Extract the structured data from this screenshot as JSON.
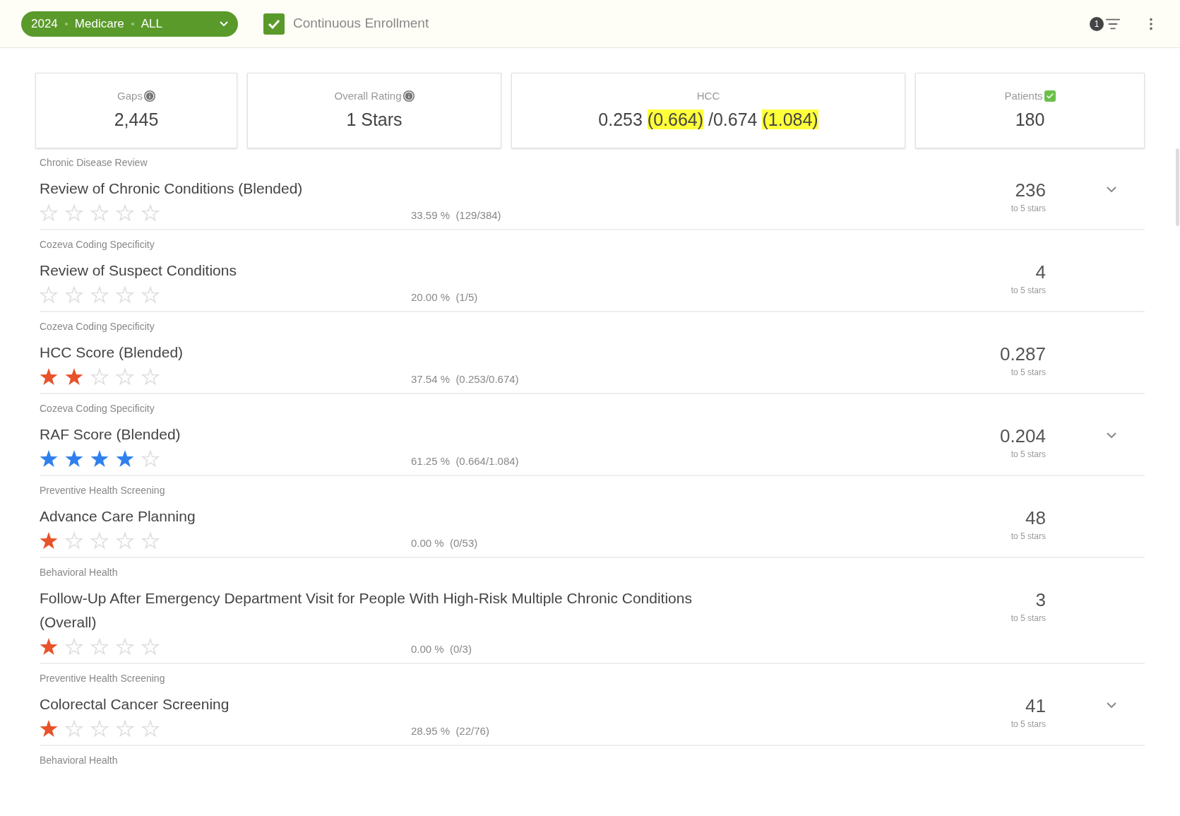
{
  "filter_pill": {
    "parts": [
      "2024",
      "Medicare",
      "ALL"
    ]
  },
  "continuous_enrollment": {
    "label": "Continuous Enrollment",
    "checked": true
  },
  "filter_badge": "1",
  "cards": [
    {
      "label": "Gaps",
      "kind": "info",
      "value_parts": [
        {
          "text": "2,445",
          "highlighted": false
        }
      ]
    },
    {
      "label": "Overall Rating",
      "kind": "info",
      "value_parts": [
        {
          "text": "1 Stars",
          "highlighted": false
        }
      ]
    },
    {
      "label": "HCC",
      "kind": "plain",
      "value_parts": [
        {
          "text": "0.253 ",
          "highlighted": false
        },
        {
          "text": "(0.664)",
          "highlighted": true
        },
        {
          "text": " /0.674 ",
          "highlighted": false
        },
        {
          "text": "(1.084)",
          "highlighted": true
        }
      ]
    },
    {
      "label": "Patients",
      "kind": "check",
      "value_parts": [
        {
          "text": "180",
          "highlighted": false
        }
      ]
    }
  ],
  "measures": [
    {
      "category": "Chronic Disease Review",
      "title": "Review of Chronic Conditions (Blended)",
      "stars": 0,
      "percentage": "33.59 %  (129/384)",
      "value": "236",
      "value_note": "to 5 stars",
      "expandable": true
    },
    {
      "category": "Cozeva Coding Specificity",
      "title": "Review of Suspect Conditions",
      "stars": 0,
      "percentage": "20.00 %  (1/5)",
      "value": "4",
      "value_note": "to 5 stars",
      "expandable": false
    },
    {
      "category": "Cozeva Coding Specificity",
      "title": "HCC Score (Blended)",
      "stars": 2,
      "color": "#e8532a",
      "percentage": "37.54 %  (0.253/0.674)",
      "value": "0.287",
      "value_note": "to 5 stars",
      "expandable": false
    },
    {
      "category": "Cozeva Coding Specificity",
      "title": "RAF Score (Blended)",
      "stars": 4,
      "color": "#2f80ed",
      "percentage": "61.25 %  (0.664/1.084)",
      "value": "0.204",
      "value_note": "to 5 stars",
      "expandable": true
    },
    {
      "category": "Preventive Health Screening",
      "title": "Advance Care Planning",
      "stars": 1,
      "color": "#e8532a",
      "percentage": "0.00 %  (0/53)",
      "value": "48",
      "value_note": "to 5 stars",
      "expandable": false
    },
    {
      "category": "Behavioral Health",
      "title": "Follow-Up After Emergency Department Visit for People With High-Risk Multiple Chronic Conditions (Overall)",
      "stars": 1,
      "color": "#e8532a",
      "percentage": "0.00 %  (0/3)",
      "value": "3",
      "value_note": "to 5 stars",
      "expandable": false
    },
    {
      "category": "Preventive Health Screening",
      "title": "Colorectal Cancer Screening",
      "stars": 1,
      "color": "#e8532a",
      "percentage": "28.95 %  (22/76)",
      "value": "41",
      "value_note": "to 5 stars",
      "expandable": true
    }
  ],
  "next_category": "Behavioral Health"
}
